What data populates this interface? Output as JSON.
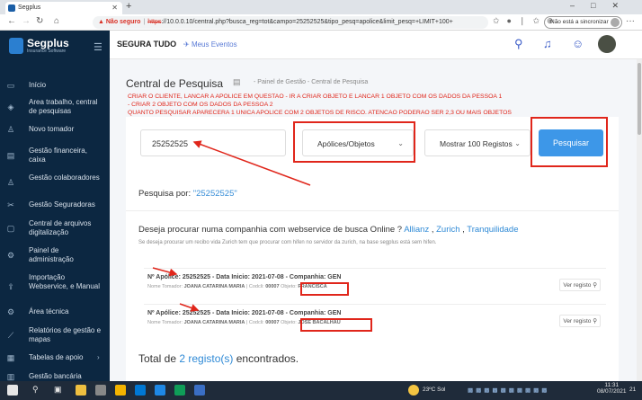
{
  "browser": {
    "tab_title": "Segplus",
    "url_warning": "Não seguro",
    "url_https": "https",
    "url_rest": "://10.0.0.10/central.php?busca_reg=tot&campo=25252525&tipo_pesq=apolice&limit_pesq=+LIMIT+100+",
    "sync_label": "Não está a sincronizar"
  },
  "sidebar": {
    "logo_name": "Segplus",
    "logo_sub": "Insurance Software",
    "items": [
      {
        "label": "Início",
        "icon": "desktop-icon"
      },
      {
        "label": "Area trabalho, central de pesquisas",
        "icon": "layers-icon"
      },
      {
        "label": "Novo tomador",
        "icon": "user-icon"
      },
      {
        "label": "Gestão financeira, caixa",
        "icon": "wallet-icon"
      },
      {
        "label": "Gestão colaboradores",
        "icon": "users-icon"
      },
      {
        "label": "Gestão Seguradoras",
        "icon": "tools-icon"
      },
      {
        "label": "Central de arquivos digitalização",
        "icon": "folder-icon"
      },
      {
        "label": "Painel de administração",
        "icon": "gear-icon"
      },
      {
        "label": "Importação Webservice, e Manual",
        "icon": "upload-icon"
      },
      {
        "label": "Área técnica",
        "icon": "cog-icon"
      },
      {
        "label": "Relatórios de gestão e mapas",
        "icon": "chart-icon"
      },
      {
        "label": "Tabelas de apoio",
        "icon": "table-icon"
      },
      {
        "label": "Gestão bancária",
        "icon": "bank-icon"
      }
    ]
  },
  "topbar": {
    "brand": "SEGURA TUDO",
    "events": "Meus Eventos"
  },
  "page": {
    "title": "Central de Pesquisa",
    "breadcrumb": "- Painel de Gestão - Central de Pesquisa",
    "notes": [
      "CRIAR O CLIENTE, LANCAR A APOLICE EM QUESTAO - IR A CRIAR OBJETO E LANCAR 1 OBJETO COM OS DADOS DA PESSOA 1",
      "- CRIAR 2 OBJETO COM OS DADOS DA PESSOA 2",
      "QUANTO PESQUISAR APARECERA 1 UNICA APOLICE COM 2 OBJETOS DE RISCO. ATENCAO PODERAO SER 2,3 OU MAIS OBJETOS"
    ]
  },
  "search": {
    "value": "25252525",
    "type_selected": "Apólices/Objetos",
    "limit_selected": "Mostrar 100 Registos",
    "button": "Pesquisar"
  },
  "results": {
    "title_prefix": "Pesquisa por:",
    "title_query": "\"25252525\"",
    "deseja_text": "Deseja procurar numa companhia com webservice de busca Online ?",
    "links": [
      "Allianz",
      "Zurich",
      "Tranquilidade"
    ],
    "hint": "Se deseja procurar um recibo vida Zurich tem que procurar com hifen no servidor da zurich, na base segplus está sem hifen.",
    "records": [
      {
        "line1": "Nº Apólice: 25252525 - Data Inicio: 2021-07-08 - Companhia: GEN",
        "tomador_label": "Nome Tomador:",
        "tomador": "JOANA CATARINA MARIA",
        "codigo_label": "| Codcli:",
        "codigo": "00007",
        "objeto_label": "Objeto:",
        "objeto": "FRANCISCA",
        "ver": "Ver registo"
      },
      {
        "line1": "Nº Apólice: 25252525 - Data Inicio: 2021-07-08 - Companhia: GEN",
        "tomador_label": "Nome Tomador:",
        "tomador": "JOANA CATARINA MARIA",
        "codigo_label": "| Codcli:",
        "codigo": "00007",
        "objeto_label": "Objeto:",
        "objeto": "JOSE BACALHAU",
        "ver": "Ver registo"
      }
    ],
    "total_prefix": "Total de",
    "total_count": "2 registo(s)",
    "total_suffix": "encontrados."
  },
  "taskbar": {
    "weather": "23ºC Sol",
    "time": "11:31",
    "date": "08/07/2021",
    "notif": "21"
  },
  "colors": {
    "sidebar": "#0c2741",
    "accent": "#3d97e8",
    "annotation": "#e0261b"
  }
}
